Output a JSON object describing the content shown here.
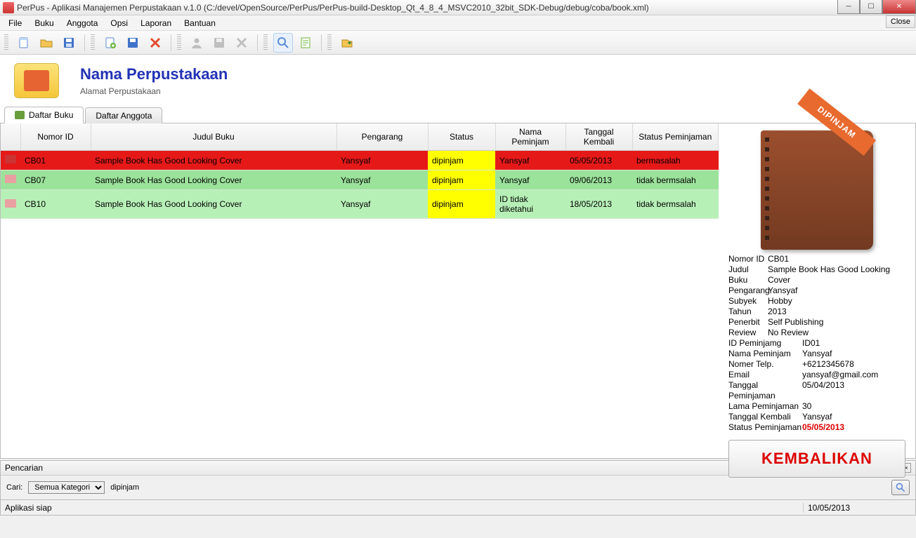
{
  "window": {
    "title": "PerPus - Aplikasi Manajemen Perpustakaan v.1.0 (C:/devel/OpenSource/PerPus/PerPus-build-Desktop_Qt_4_8_4_MSVC2010_32bit_SDK-Debug/debug/coba/book.xml)",
    "close_tab_label": "Close"
  },
  "menu": {
    "file": "File",
    "buku": "Buku",
    "anggota": "Anggota",
    "opsi": "Opsi",
    "laporan": "Laporan",
    "bantuan": "Bantuan"
  },
  "header": {
    "library_name": "Nama Perpustakaan",
    "library_address": "Alamat Perpustakaan"
  },
  "tabs": {
    "daftar_buku": "Daftar Buku",
    "daftar_anggota": "Daftar Anggota"
  },
  "table": {
    "columns": {
      "nomor_id": "Nomor ID",
      "judul_buku": "Judul Buku",
      "pengarang": "Pengarang",
      "status": "Status",
      "nama_peminjam": "Nama Peminjam",
      "tanggal_kembali": "Tanggal Kembali",
      "status_peminjaman": "Status Peminjaman"
    },
    "rows": [
      {
        "id": "CB01",
        "judul": "Sample Book Has Good Looking Cover",
        "pengarang": "Yansyaf",
        "status": "dipinjam",
        "peminjam": "Yansyaf",
        "tgl_kembali": "05/05/2013",
        "status_pinjam": "bermasalah",
        "row_class": "row-red"
      },
      {
        "id": "CB07",
        "judul": "Sample Book Has Good Looking Cover",
        "pengarang": "Yansyaf",
        "status": "dipinjam",
        "peminjam": "Yansyaf",
        "tgl_kembali": "09/06/2013",
        "status_pinjam": "tidak bermsalah",
        "row_class": "row-green"
      },
      {
        "id": "CB10",
        "judul": "Sample Book Has Good Looking Cover",
        "pengarang": "Yansyaf",
        "status": "dipinjam",
        "peminjam": "ID tidak diketahui",
        "tgl_kembali": "18/05/2013",
        "status_pinjam": "tidak bermsalah",
        "row_class": "row-green-alt"
      }
    ]
  },
  "details": {
    "ribbon": "DIPINJAM",
    "labels": {
      "nomor_id": "Nomor ID",
      "judul_buku": "Judul Buku",
      "pengarang": "Pengarang",
      "subyek": "Subyek",
      "tahun": "Tahun",
      "penerbit": "Penerbit",
      "review": "Review",
      "id_peminjam": "ID Peminjamg",
      "nama_peminjam": "Nama Peminjam",
      "nomer_telp": "Nomer Telp.",
      "email": "Email",
      "tgl_pinjam": "Tanggal Peminjaman",
      "lama_pinjam": "Lama Peminjaman",
      "tgl_kembali": "Tanggal Kembali",
      "status_pinjam": "Status Peminjaman"
    },
    "values": {
      "nomor_id": "CB01",
      "judul_buku": "Sample Book Has Good Looking Cover",
      "pengarang": "Yansyaf",
      "subyek": "Hobby",
      "tahun": "2013",
      "penerbit": "Self Publishing",
      "review": "No Review",
      "id_peminjam": "ID01",
      "nama_peminjam": "Yansyaf",
      "nomer_telp": "+6212345678",
      "email": "yansyaf@gmail.com",
      "tgl_pinjam": "05/04/2013",
      "lama_pinjam": "30",
      "tgl_kembali": "Yansyaf",
      "status_pinjam": "05/05/2013"
    },
    "return_button": "KEMBALIKAN"
  },
  "search": {
    "panel_title": "Pencarian",
    "cari_label": "Cari:",
    "category_selected": "Semua Kategori",
    "query": "dipinjam"
  },
  "statusbar": {
    "message": "Aplikasi siap",
    "date": "10/05/2013"
  }
}
